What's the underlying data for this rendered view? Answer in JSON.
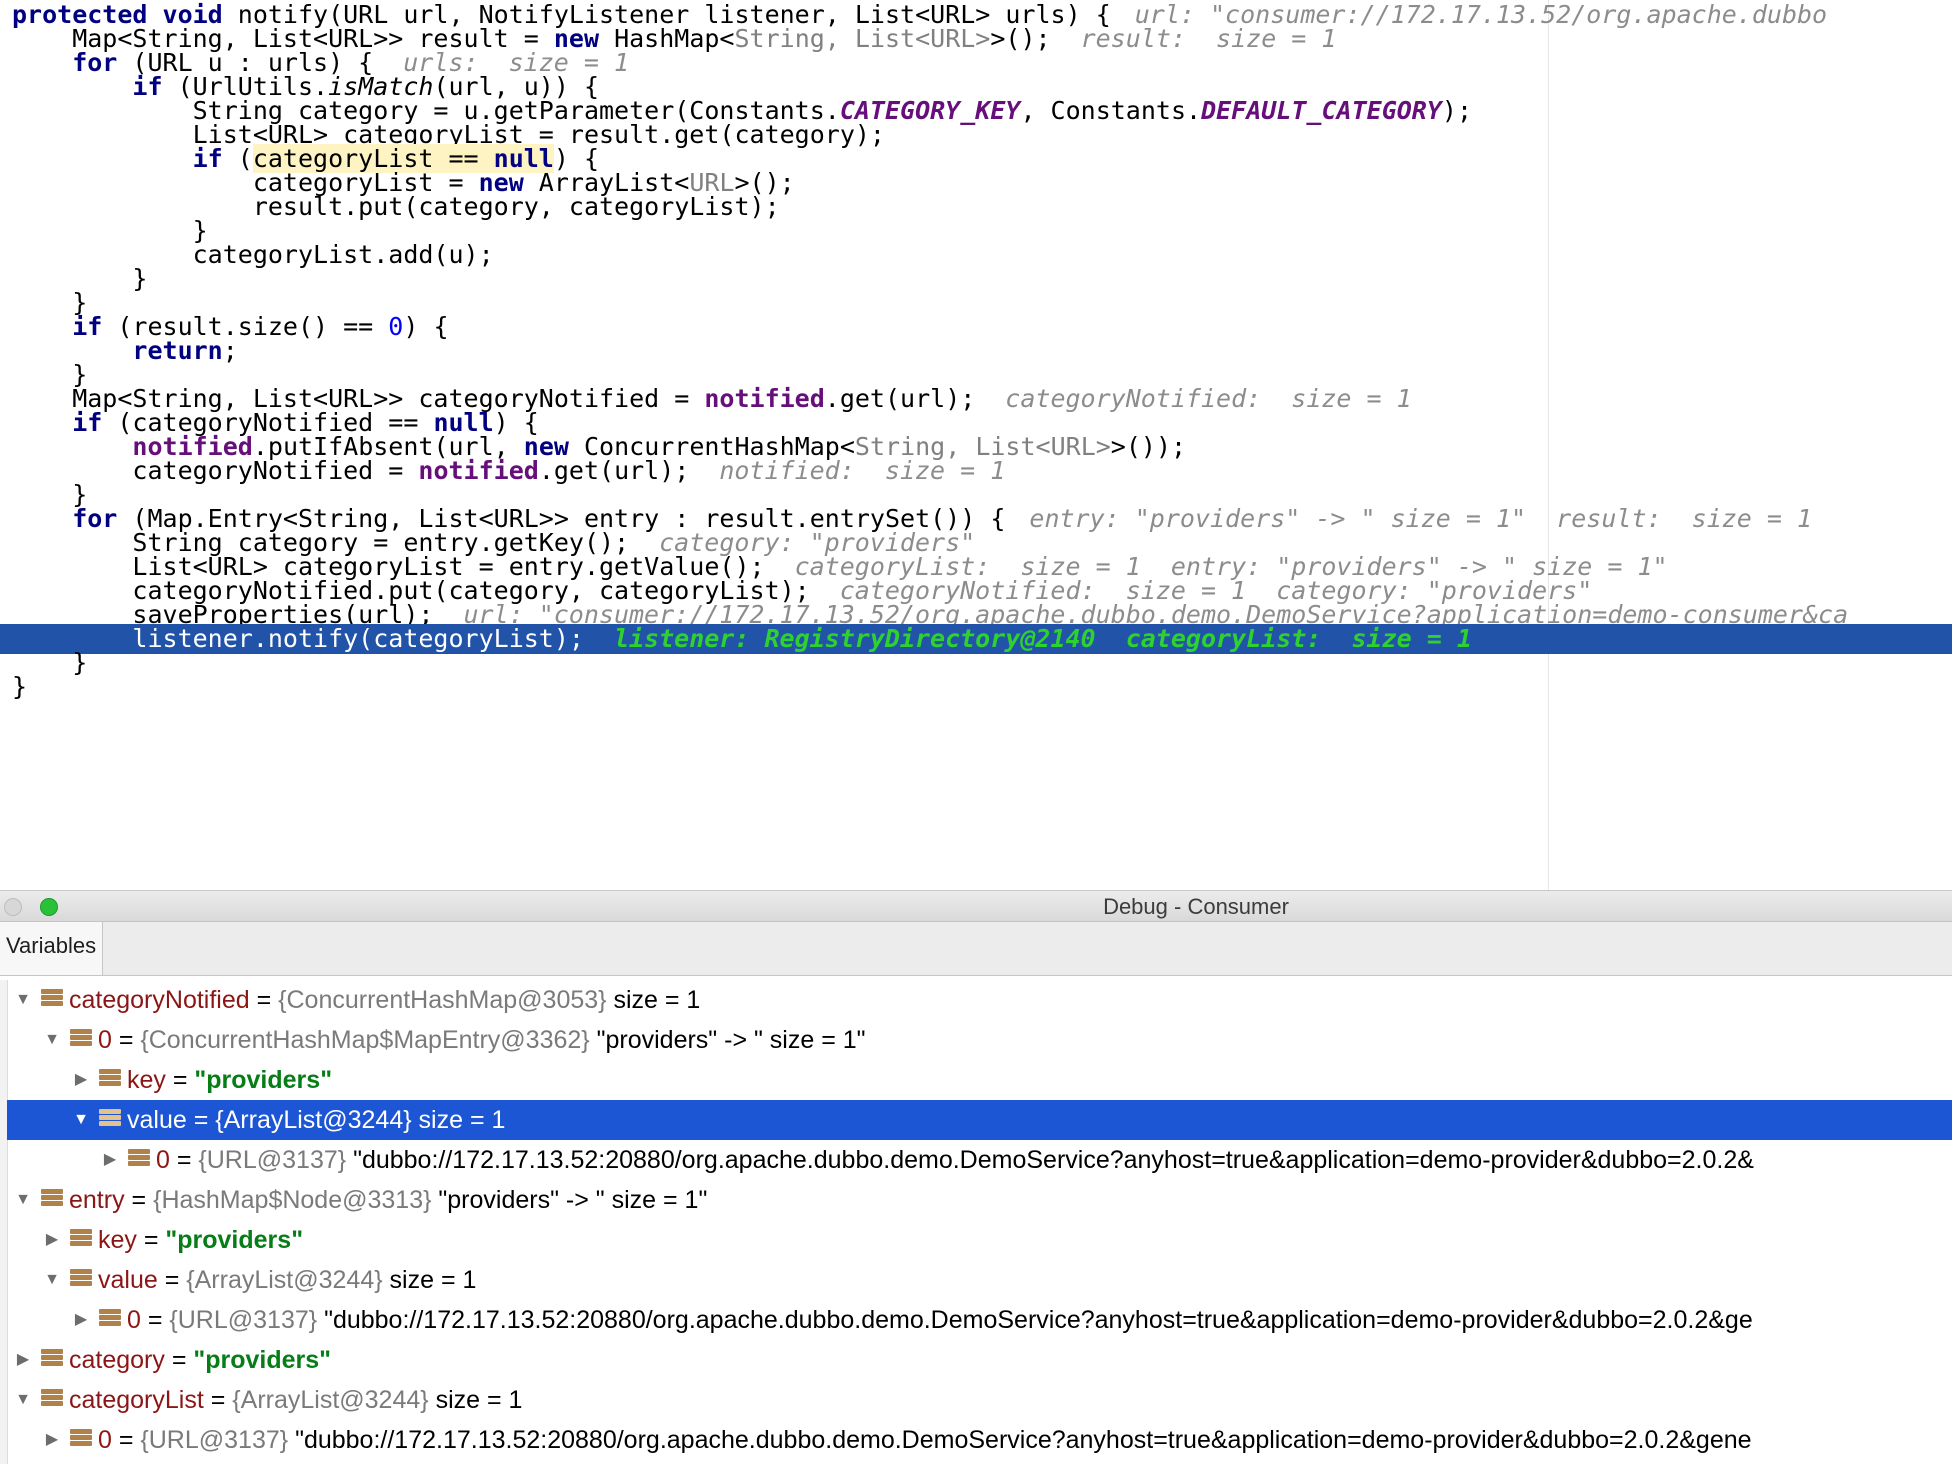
{
  "editor": {
    "code": {
      "l1": {
        "kw": "protected void",
        "text": " notify(URL url, NotifyListener listener, List<URL> urls) {",
        "hint": "url: \"consumer://172.17.13.52/org.apache.dubbo"
      },
      "l2": {
        "a": "    Map<String, List<URL>> result = ",
        "kw": "new",
        "b": " HashMap<",
        "g1": "String, List<URL>",
        "c": ">();",
        "hint": "result:  size = 1"
      },
      "l3": {
        "kw": "    for",
        "text": " (URL u : urls) {",
        "hint": "urls:  size = 1"
      },
      "l4": {
        "kw": "        if",
        "a": " (UrlUtils.",
        "it": "isMatch",
        "b": "(url, u)) {"
      },
      "l5": {
        "a": "            String category = u.getParameter(Constants.",
        "s1": "CATEGORY_KEY",
        "b": ", Constants.",
        "s2": "DEFAULT_CATEGORY",
        "c": ");"
      },
      "l6": {
        "text": "            List<URL> categoryList = result.get(category);"
      },
      "l7": {
        "kw": "            if",
        "a": " (",
        "hl": "categoryList == ",
        "kw2": "null",
        "b": ") {"
      },
      "l8": {
        "a": "                categoryList = ",
        "kw": "new",
        "b": " ArrayList<",
        "g": "URL",
        "c": ">();"
      },
      "l9": {
        "text": "                result.put(category, categoryList);"
      },
      "l10": {
        "text": "            }"
      },
      "l11": {
        "text": "            categoryList.add(u);"
      },
      "l12": {
        "text": "        }"
      },
      "l13": {
        "text": "    }"
      },
      "l14": {
        "kw": "    if",
        "a": " (result.size() == ",
        "num": "0",
        "b": ") {"
      },
      "l15": {
        "kw": "        return",
        "text": ";"
      },
      "l16": {
        "text": "    }"
      },
      "l17": {
        "a": "    Map<String, List<URL>> categoryNotified = ",
        "fld": "notified",
        "b": ".get(url);",
        "hint": "categoryNotified:  size = 1"
      },
      "l18": {
        "kw": "    if",
        "a": " (categoryNotified == ",
        "kw2": "null",
        "b": ") {"
      },
      "l19": {
        "pre": "        ",
        "fld": "notified",
        "a": ".putIfAbsent(url, ",
        "kw": "new",
        "b": " ConcurrentHashMap<",
        "g": "String, List<URL>",
        "c": ">());"
      },
      "l20": {
        "a": "        categoryNotified = ",
        "fld": "notified",
        "b": ".get(url);",
        "hint": "notified:  size = 1"
      },
      "l21": {
        "text": "    }"
      },
      "l22": {
        "kw": "    for",
        "text": " (Map.Entry<String, List<URL>> entry : result.entrySet()) {",
        "hint": "entry: \"providers\" -> \" size = 1\"  result:  size = 1"
      },
      "l23": {
        "text": "        String category = entry.getKey();",
        "hint": "category: \"providers\""
      },
      "l24": {
        "text": "        List<URL> categoryList = entry.getValue();",
        "hint": "categoryList:  size = 1  entry: \"providers\" -> \" size = 1\""
      },
      "l25": {
        "text": "        categoryNotified.put(category, categoryList);",
        "hint": "categoryNotified:  size = 1  category: \"providers\""
      },
      "l26": {
        "text": "        saveProperties(url);",
        "hint": "url: \"consumer://172.17.13.52/org.apache.dubbo.demo.DemoService?application=demo-consumer&ca"
      },
      "l27": {
        "text": "        listener.notify(categoryList);",
        "hint": "listener: RegistryDirectory@2140  categoryList:  size = 1"
      },
      "l28": {
        "text": "    }"
      },
      "l29": {
        "text": "}"
      }
    }
  },
  "debug": {
    "window_title": "Debug - Consumer",
    "tab_label": "Variables",
    "vars": [
      {
        "name": "categoryNotified",
        "eq": " = ",
        "ref": "{ConcurrentHashMap@3053}",
        "extra": "  size = 1"
      },
      {
        "name": "0",
        "eq": " = ",
        "ref": "{ConcurrentHashMap$MapEntry@3362}",
        "extra": " \"providers\" -> \" size = 1\""
      },
      {
        "name": "key",
        "eq": " = ",
        "str": "\"providers\""
      },
      {
        "name": "value",
        "eq": " = ",
        "ref": "{ArrayList@3244}",
        "extra": "  size = 1"
      },
      {
        "name": "0",
        "eq": " = ",
        "ref": "{URL@3137}",
        "extra": " \"dubbo://172.17.13.52:20880/org.apache.dubbo.demo.DemoService?anyhost=true&application=demo-provider&dubbo=2.0.2&"
      },
      {
        "name": "entry",
        "eq": " = ",
        "ref": "{HashMap$Node@3313}",
        "extra": " \"providers\" -> \" size = 1\""
      },
      {
        "name": "key",
        "eq": " = ",
        "str": "\"providers\""
      },
      {
        "name": "value",
        "eq": " = ",
        "ref": "{ArrayList@3244}",
        "extra": "  size = 1"
      },
      {
        "name": "0",
        "eq": " = ",
        "ref": "{URL@3137}",
        "extra": " \"dubbo://172.17.13.52:20880/org.apache.dubbo.demo.DemoService?anyhost=true&application=demo-provider&dubbo=2.0.2&ge"
      },
      {
        "name": "category",
        "eq": " = ",
        "str": "\"providers\""
      },
      {
        "name": "categoryList",
        "eq": " = ",
        "ref": "{ArrayList@3244}",
        "extra": "  size = 1"
      },
      {
        "name": "0",
        "eq": " = ",
        "ref": "{URL@3137}",
        "extra": " \"dubbo://172.17.13.52:20880/org.apache.dubbo.demo.DemoService?anyhost=true&application=demo-provider&dubbo=2.0.2&gene"
      }
    ]
  },
  "icons": {
    "expanded": "triangle-down-icon",
    "collapsed": "triangle-right-icon",
    "field": "field-icon"
  },
  "colors": {
    "execution_line": "#2154a8",
    "selected_row": "#1c56d4",
    "keyword": "#000080",
    "string_value": "#067d17",
    "variable_name": "#8c1616"
  }
}
